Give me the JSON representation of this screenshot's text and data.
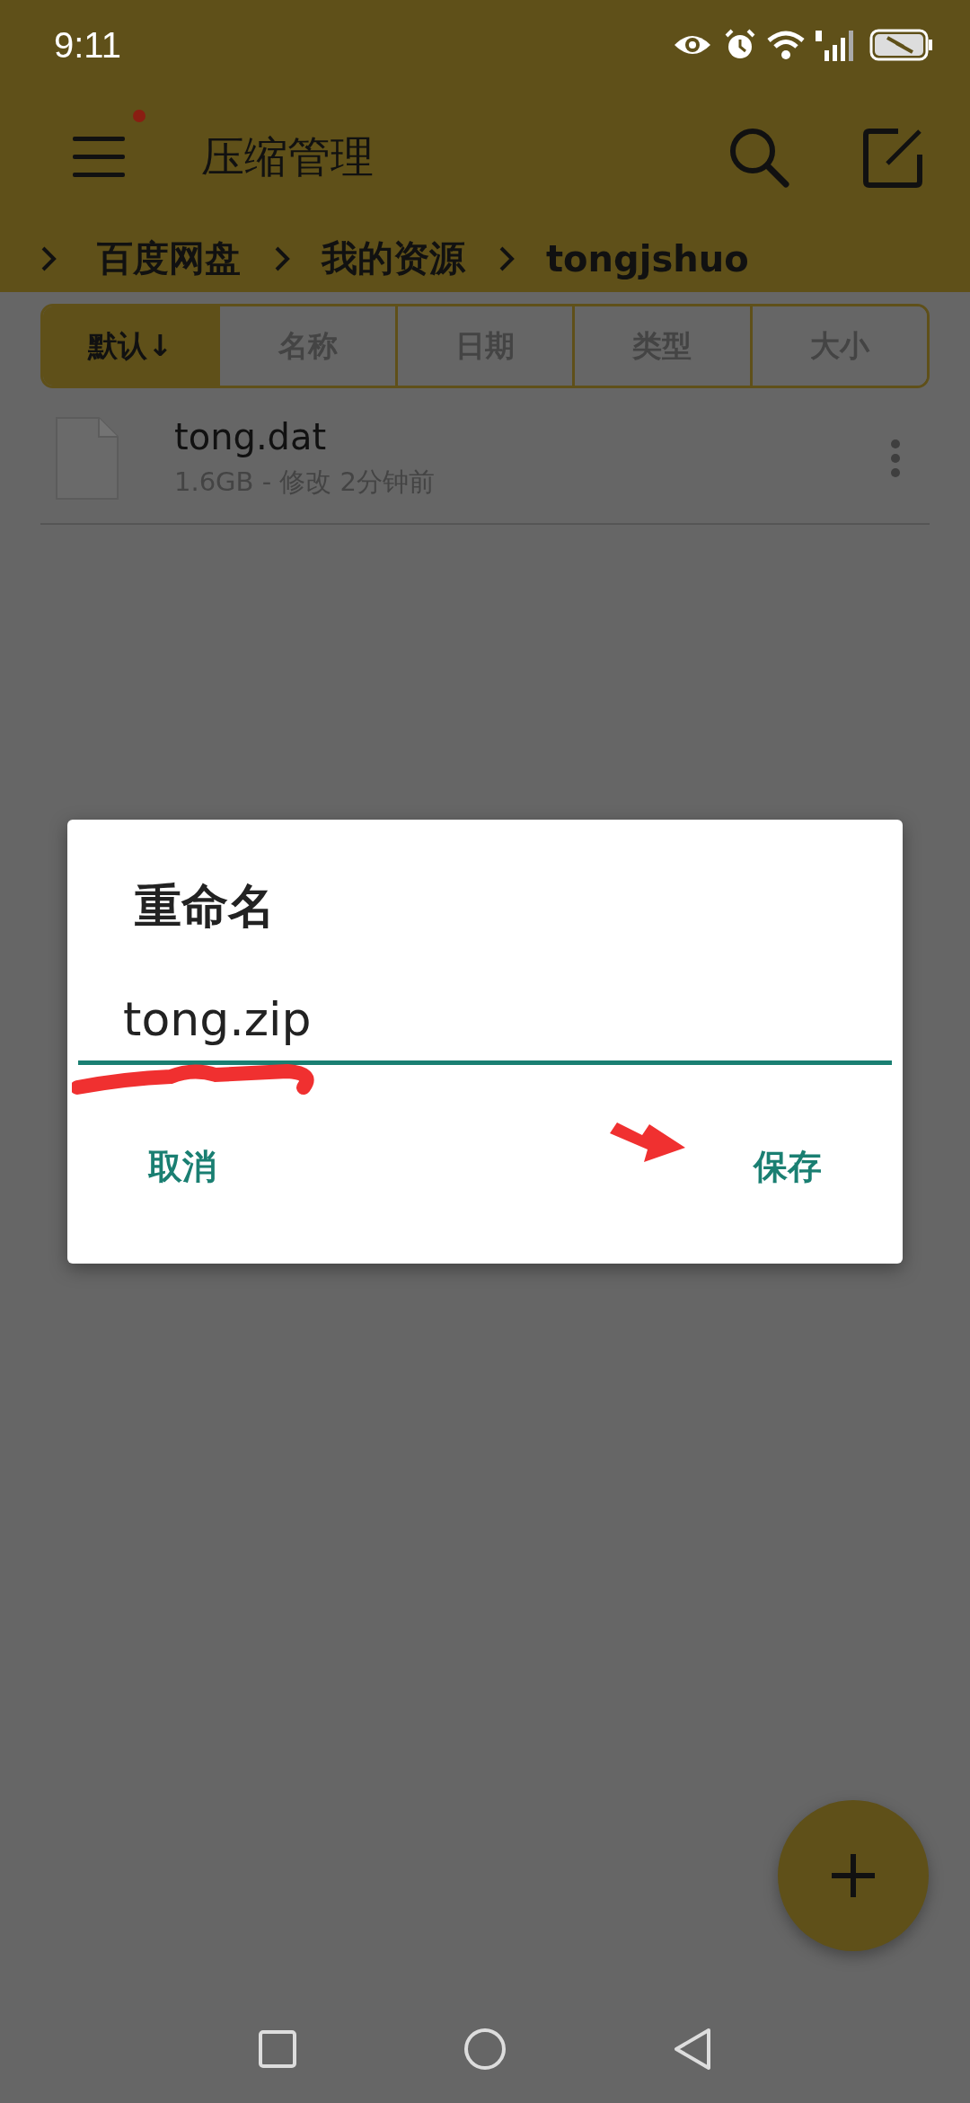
{
  "status_bar": {
    "time": "9:11"
  },
  "toolbar": {
    "title": "压缩管理",
    "unread": true
  },
  "breadcrumb": [
    {
      "label": "百度网盘"
    },
    {
      "label": "我的资源"
    },
    {
      "label": "tongjshuo"
    }
  ],
  "sort_tabs": [
    {
      "label": "默认↓",
      "selected": true
    },
    {
      "label": "名称",
      "selected": false
    },
    {
      "label": "日期",
      "selected": false
    },
    {
      "label": "类型",
      "selected": false
    },
    {
      "label": "大小",
      "selected": false
    }
  ],
  "files": [
    {
      "name": "tong.dat",
      "meta": "1.6GB - 修改 2分钟前"
    }
  ],
  "dialog": {
    "title": "重命名",
    "value": "tong.zip",
    "buttons": [
      {
        "label": "取消"
      },
      {
        "label": "保存"
      }
    ]
  }
}
